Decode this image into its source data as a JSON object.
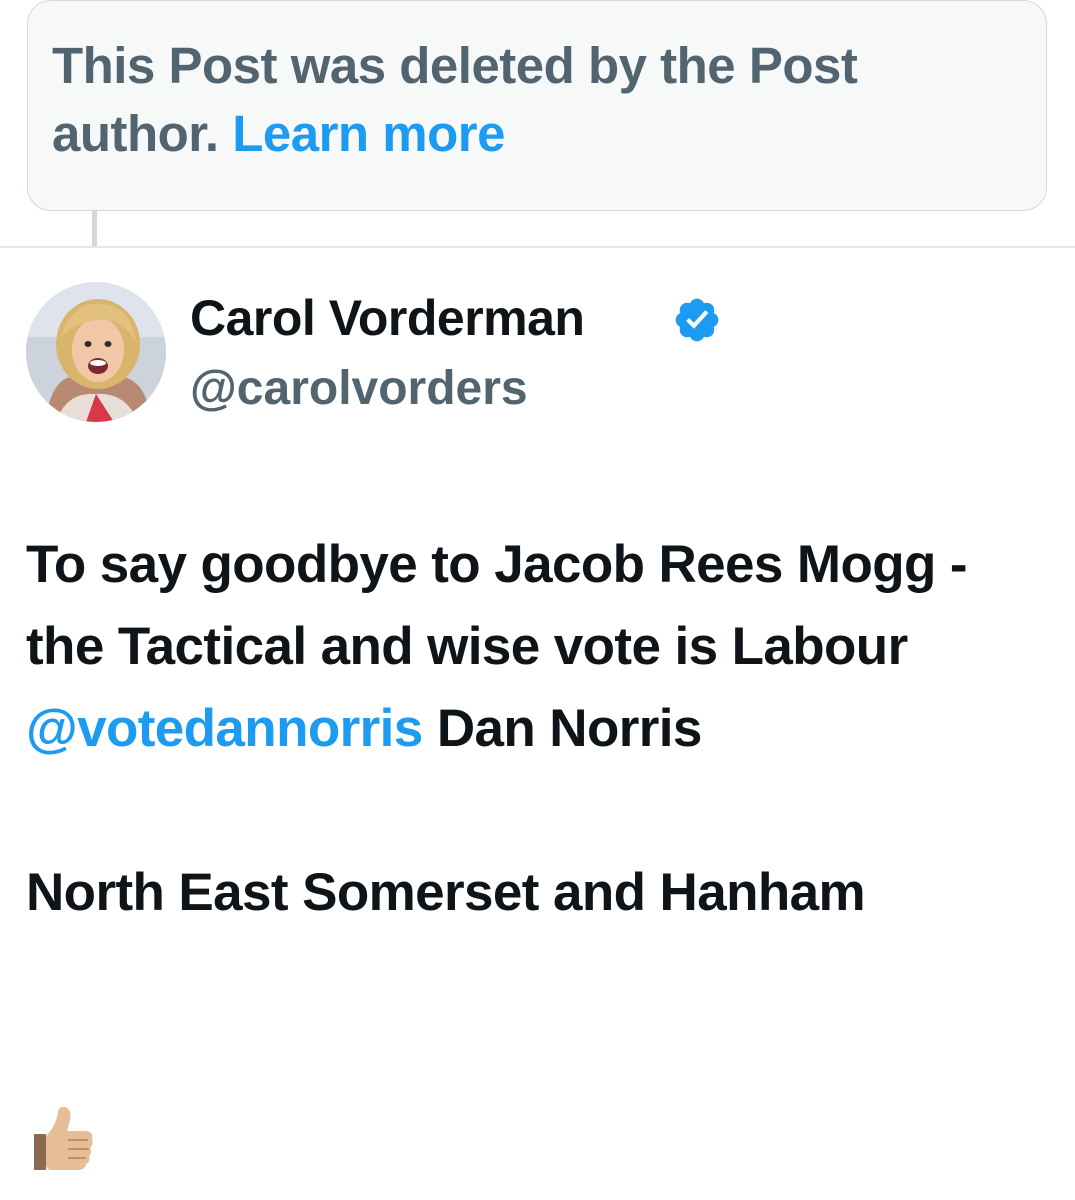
{
  "deleted_notice": {
    "text": "This Post was deleted by the Post author.",
    "link_label": "Learn more"
  },
  "author": {
    "display_name": "Carol Vorderman",
    "handle": "@carolvorders",
    "verified_icon": "verified-badge-icon",
    "verified_color": "#1d9bf0"
  },
  "post": {
    "line1_before": "To say goodbye to Jacob Rees Mogg -  the Tactical and wise vote is Labour ",
    "mention": "@votedannorris",
    "line1_after": " Dan Norris",
    "line2": "North East Somerset and Hanham",
    "emoji": "👍🏼"
  },
  "colors": {
    "link": "#1d9bf0",
    "text_primary": "#0f1419",
    "text_secondary": "#536471",
    "border": "#cfd9de"
  }
}
